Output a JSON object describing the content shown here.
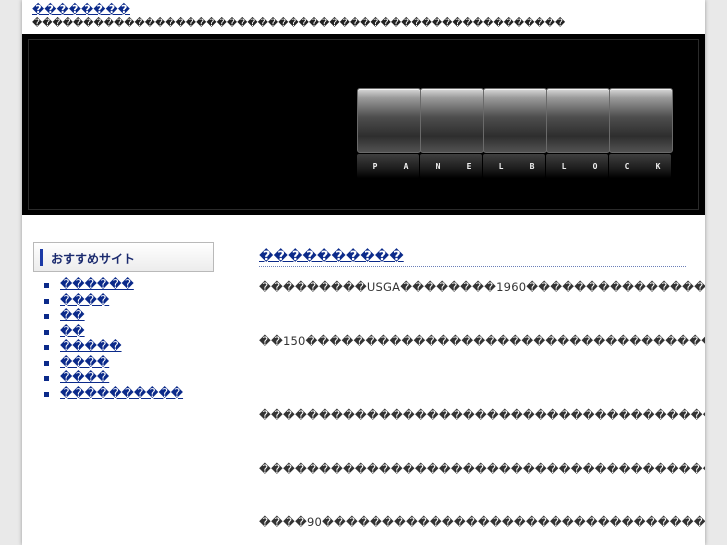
{
  "site": {
    "title": "��������",
    "description": "����������������������������������������������������"
  },
  "banner": {
    "logo_letters": [
      "P",
      "A",
      "N",
      "E",
      "L",
      "B",
      "L",
      "O",
      "C",
      "K"
    ]
  },
  "sidebar": {
    "heading": "おすすめサイト",
    "links": [
      "������",
      "����",
      "��",
      "��",
      "�����",
      "����",
      "����",
      "����������"
    ]
  },
  "main": {
    "title": "����������",
    "paragraphs": [
      "���������USGA��������1960�������������������������������������������������������������������������������������",
      "��150�������������������������������������������������������������������������������������������������������������������������������������������",
      "����������������������������������������������������������������������������",
      "���������������������������������������������������������������������������������",
      "����90��������������������������������������������������������������������������"
    ]
  }
}
